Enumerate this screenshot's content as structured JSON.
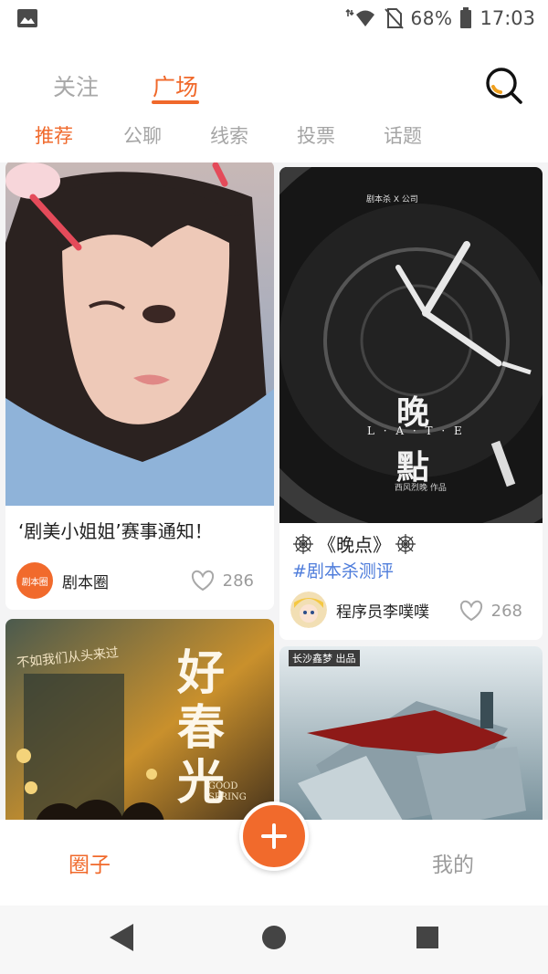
{
  "status_bar": {
    "battery_percent": "68%",
    "time": "17:03",
    "icons": [
      "gallery-icon",
      "wifi-icon",
      "no-sim-icon",
      "battery-icon"
    ]
  },
  "header": {
    "tabs": [
      {
        "label": "关注",
        "active": false
      },
      {
        "label": "广场",
        "active": true
      }
    ],
    "search_icon": "search-icon",
    "subtabs": [
      {
        "label": "推荐",
        "active": true
      },
      {
        "label": "公聊",
        "active": false
      },
      {
        "label": "线索",
        "active": false
      },
      {
        "label": "投票",
        "active": false
      },
      {
        "label": "话题",
        "active": false
      }
    ]
  },
  "feed": {
    "cards": [
      {
        "title": "‘剧美小姐姐’赛事通知！",
        "author": "剧本圈",
        "author_avatar_text": "剧本圈",
        "likes": "286"
      },
      {
        "title": "《晚点》",
        "tag": "#剧本杀测评",
        "author": "程序员李噗噗",
        "likes": "268",
        "poster": {
          "title_line1": "晚",
          "title_line2": "點",
          "subtitle": "L · A · T · E",
          "credit": "西风烈晚 作品"
        }
      },
      {
        "poster": {
          "title_vertical": "好春光",
          "english": "GOOD SPRING",
          "slogan": "不如我们从头来过"
        }
      },
      {
        "poster": {
          "corner_text": "长沙鑫梦 出品"
        }
      }
    ]
  },
  "bottom_nav": {
    "left_label": "圈子",
    "right_label": "我的",
    "fab_icon": "plus-icon"
  },
  "colors": {
    "accent": "#f0692b",
    "tag_blue": "#4f7ddb",
    "muted_text": "#a5a5a5"
  }
}
